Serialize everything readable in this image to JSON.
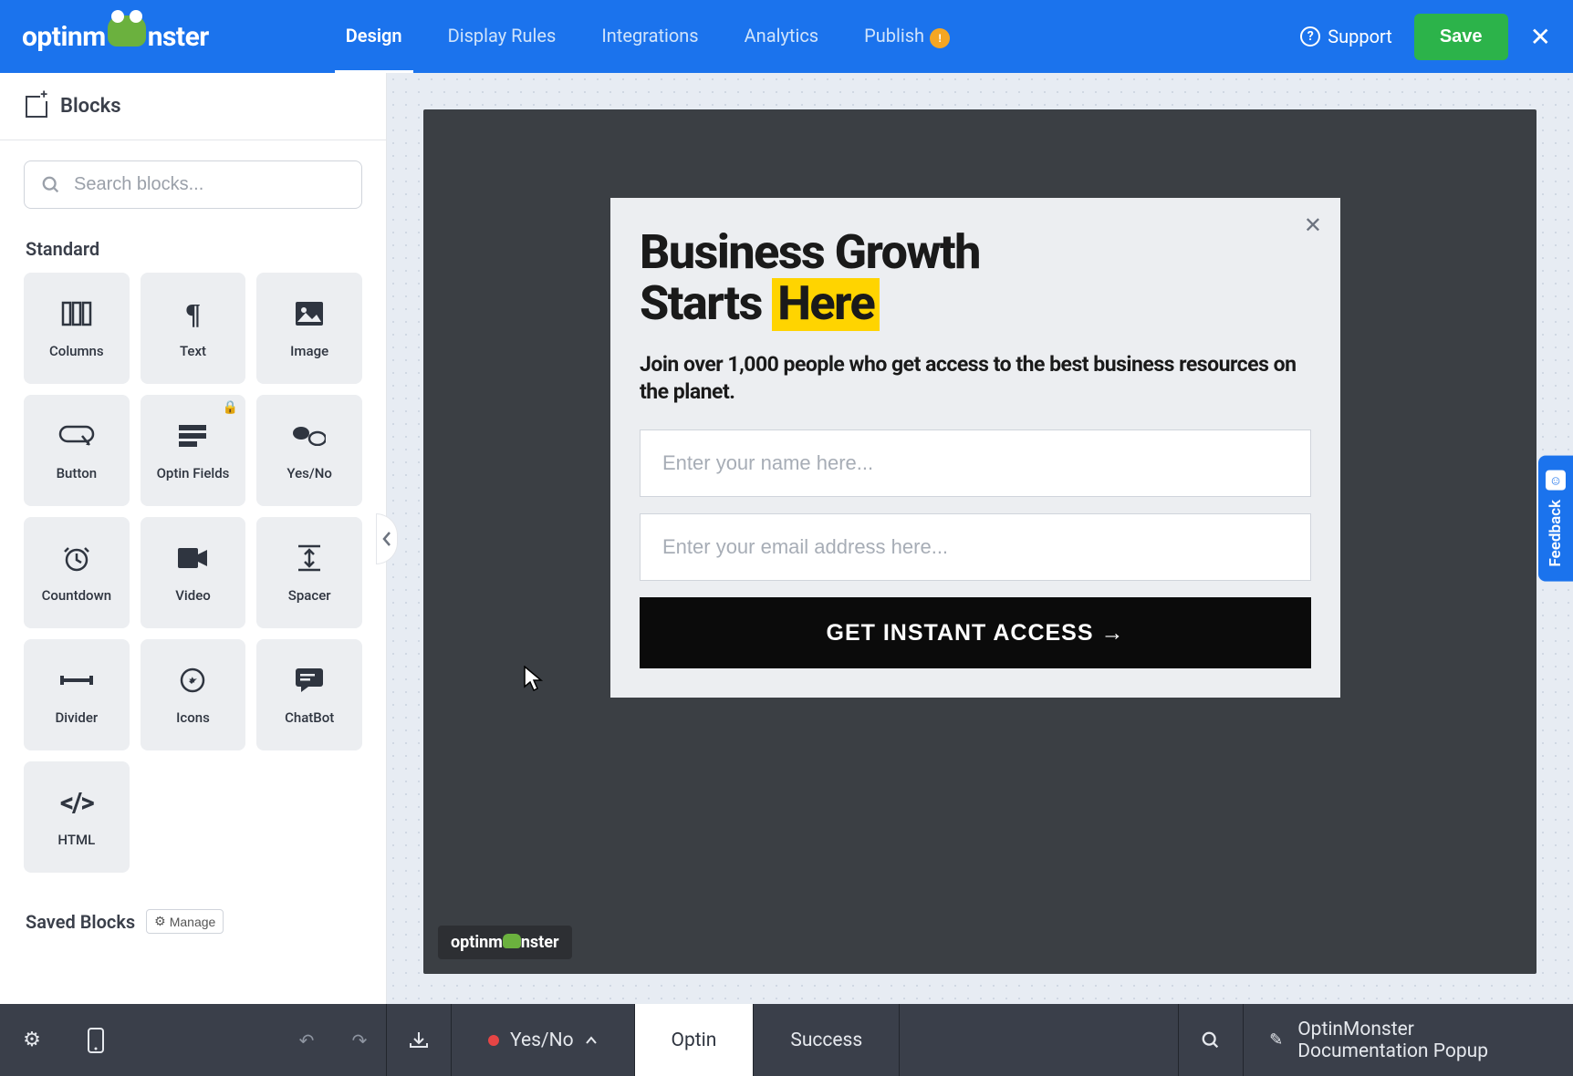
{
  "brand": "optinmonster",
  "nav": {
    "tabs": [
      "Design",
      "Display Rules",
      "Integrations",
      "Analytics",
      "Publish"
    ],
    "active": "Design",
    "publish_badge": "!",
    "support": "Support",
    "save": "Save"
  },
  "sidebar": {
    "title": "Blocks",
    "search_placeholder": "Search blocks...",
    "section_standard": "Standard",
    "blocks": [
      {
        "label": "Columns",
        "icon": "columns"
      },
      {
        "label": "Text",
        "icon": "text"
      },
      {
        "label": "Image",
        "icon": "image"
      },
      {
        "label": "Button",
        "icon": "button"
      },
      {
        "label": "Optin Fields",
        "icon": "fields",
        "locked": true
      },
      {
        "label": "Yes/No",
        "icon": "yesno"
      },
      {
        "label": "Countdown",
        "icon": "clock"
      },
      {
        "label": "Video",
        "icon": "video"
      },
      {
        "label": "Spacer",
        "icon": "spacer"
      },
      {
        "label": "Divider",
        "icon": "divider"
      },
      {
        "label": "Icons",
        "icon": "icons"
      },
      {
        "label": "ChatBot",
        "icon": "chat"
      },
      {
        "label": "HTML",
        "icon": "html"
      }
    ],
    "section_saved": "Saved Blocks",
    "manage": "Manage"
  },
  "popup": {
    "headline_1": "Business Growth",
    "headline_2a": "Starts ",
    "headline_2b": "Here",
    "sub": "Join over 1,000 people who get access to the best business resources on the planet.",
    "name_placeholder": "Enter your name here...",
    "email_placeholder": "Enter your email address here...",
    "cta": "GET INSTANT ACCESS →",
    "watermark": "optinmonster"
  },
  "bottombar": {
    "yesno": "Yes/No",
    "optin": "Optin",
    "success": "Success",
    "campaign": "OptinMonster Documentation Popup"
  },
  "feedback": "Feedback"
}
